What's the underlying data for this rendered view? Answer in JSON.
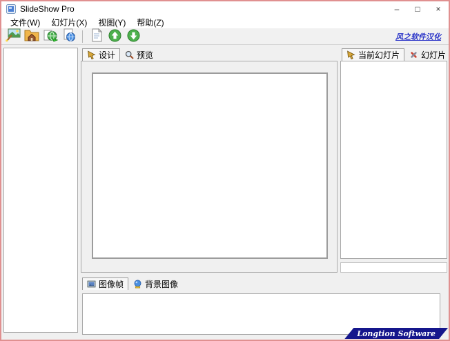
{
  "window": {
    "title": "SlideShow Pro",
    "controls": {
      "minimize": "–",
      "maximize": "□",
      "close": "×"
    }
  },
  "menu": {
    "items": [
      {
        "label": "文件(W)"
      },
      {
        "label": "幻灯片(X)"
      },
      {
        "label": "视图(Y)"
      },
      {
        "label": "帮助(Z)"
      }
    ]
  },
  "toolbar": {
    "buttons": [
      {
        "name": "new-slideshow-wizard"
      },
      {
        "name": "open-project"
      },
      {
        "name": "publish-slideshow"
      },
      {
        "name": "preview-in-browser"
      },
      {
        "name": "slideshow-properties"
      },
      {
        "name": "move-up"
      },
      {
        "name": "move-down"
      }
    ],
    "localization_link": {
      "label": "风之软件汉化",
      "color": "#2b35c8"
    }
  },
  "design_area": {
    "tabs": [
      {
        "label": "设计",
        "active": true
      },
      {
        "label": "预览",
        "active": false
      }
    ]
  },
  "right_panel": {
    "tabs": [
      {
        "label": "当前幻灯片",
        "active": true
      },
      {
        "label": "幻灯片",
        "active": false
      }
    ]
  },
  "bottom_panel": {
    "tabs": [
      {
        "label": "图像帧",
        "active": true
      },
      {
        "label": "背景图像",
        "active": false
      }
    ]
  },
  "footer": {
    "brand": "Longtion Software",
    "background": "#15168c"
  },
  "colors": {
    "window_frame": "#e09090",
    "toolbar_bg": "#f1f1f1",
    "panel_border": "#a9a9a9",
    "accent_green": "#4db04d",
    "link_blue": "#2b35c8"
  },
  "icons": {
    "minimize-icon": "–",
    "maximize-icon": "□",
    "close-icon": "×",
    "pointer-icon": "➤",
    "magnifier-icon": "🔍",
    "tools-icon": "🔧",
    "picture-icon": "🖼",
    "globe-icon": "🌐",
    "document-icon": "📄",
    "up-arrow-icon": "⬆",
    "down-arrow-icon": "⬇"
  }
}
